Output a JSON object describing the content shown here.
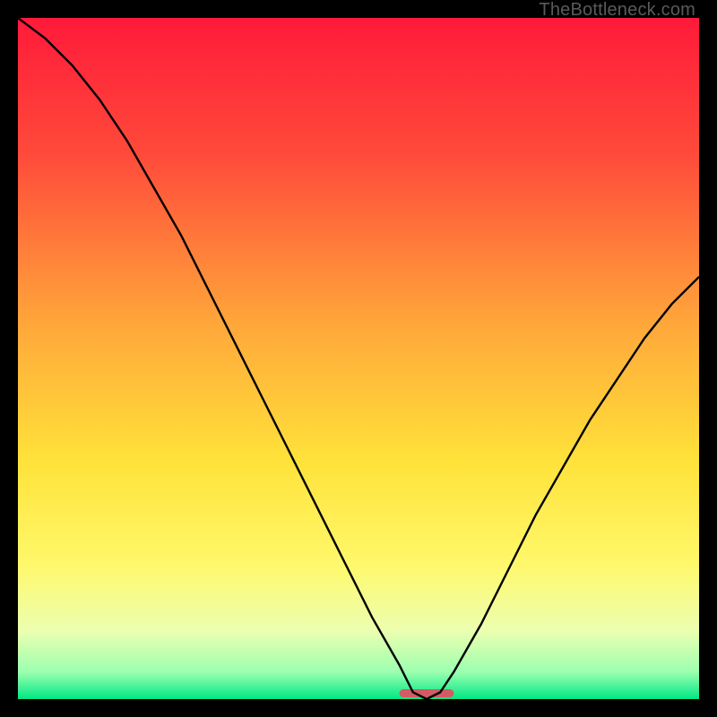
{
  "watermark": "TheBottleneck.com",
  "colors": {
    "frame": "#000000",
    "curve": "#000000",
    "sweet_spot": "#d45a63",
    "gradient_stops": [
      {
        "offset": 0.0,
        "color": "#ff1a3a"
      },
      {
        "offset": 0.2,
        "color": "#ff4a3a"
      },
      {
        "offset": 0.45,
        "color": "#ffa73a"
      },
      {
        "offset": 0.65,
        "color": "#ffe23a"
      },
      {
        "offset": 0.8,
        "color": "#fff86a"
      },
      {
        "offset": 0.9,
        "color": "#ecffb0"
      },
      {
        "offset": 0.96,
        "color": "#9cffb0"
      },
      {
        "offset": 1.0,
        "color": "#00e884"
      }
    ]
  },
  "chart_data": {
    "type": "line",
    "title": "",
    "xlabel": "",
    "ylabel": "",
    "xlim": [
      0,
      100
    ],
    "ylim": [
      0,
      100
    ],
    "x": [
      0,
      4,
      8,
      12,
      16,
      20,
      24,
      28,
      32,
      36,
      40,
      44,
      48,
      52,
      56,
      58,
      60,
      62,
      64,
      68,
      72,
      76,
      80,
      84,
      88,
      92,
      96,
      100
    ],
    "values": [
      100,
      97,
      93,
      88,
      82,
      75,
      68,
      60,
      52,
      44,
      36,
      28,
      20,
      12,
      5,
      1,
      0,
      1,
      4,
      11,
      19,
      27,
      34,
      41,
      47,
      53,
      58,
      62
    ],
    "sweet_spot": {
      "x_start": 56,
      "x_end": 64,
      "y": 0
    }
  }
}
